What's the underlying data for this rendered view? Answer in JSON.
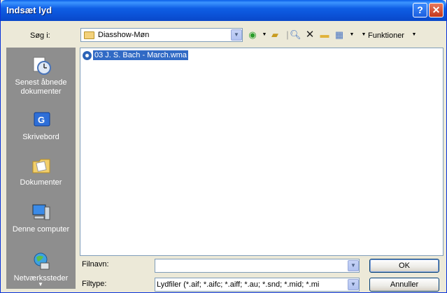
{
  "window": {
    "title": "Indsæt lyd",
    "help_icon": "?",
    "close_icon": "✕"
  },
  "lookin": {
    "label": "Søg i:",
    "value": "Diasshow-Møn"
  },
  "toolbar": {
    "tools_label": "Funktioner",
    "icons": [
      "back-icon",
      "up-folder-icon",
      "search-web-icon",
      "delete-icon",
      "new-folder-icon",
      "views-icon"
    ]
  },
  "places": [
    {
      "label": "Senest åbnede dokumenter",
      "icon": "recent-documents-icon"
    },
    {
      "label": "Skrivebord",
      "icon": "desktop-icon"
    },
    {
      "label": "Dokumenter",
      "icon": "my-documents-icon"
    },
    {
      "label": "Denne computer",
      "icon": "my-computer-icon"
    },
    {
      "label": "Netværkssteder",
      "icon": "network-places-icon"
    }
  ],
  "files": [
    {
      "name": "03 J. S. Bach - March.wma",
      "selected": true
    }
  ],
  "filename": {
    "label": "Filnavn:",
    "value": ""
  },
  "filetype": {
    "label": "Filtype:",
    "value": "Lydfiler (*.aif; *.aifc; *.aiff; *.au; *.snd; *.mid; *.mi"
  },
  "buttons": {
    "ok": "OK",
    "cancel": "Annuller"
  },
  "colors": {
    "titlebar": "#0b53d8",
    "places_bg": "#8e8e8e",
    "selection": "#316ac5",
    "dialog_bg": "#ece9d8"
  }
}
